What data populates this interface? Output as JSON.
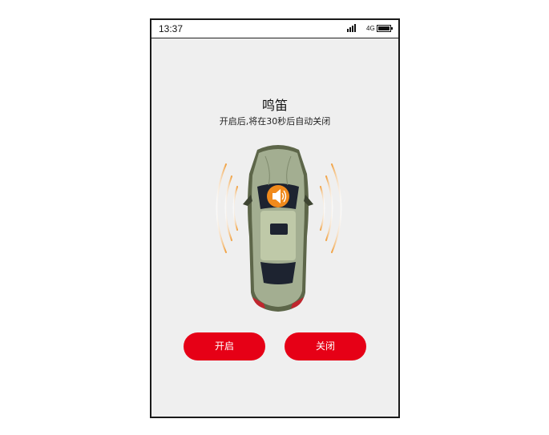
{
  "status_bar": {
    "time": "13:37",
    "network": "4G",
    "icons": [
      "signal-icon",
      "battery-icon"
    ]
  },
  "horn": {
    "title": "鸣笛",
    "subtitle": "开启后,将在30秒后自动关闭",
    "icon": "horn-icon"
  },
  "buttons": {
    "on_label": "开启",
    "off_label": "关闭"
  },
  "colors": {
    "accent": "#e60016",
    "horn_badge": "#f08a1c",
    "car_body": "#9aa58a",
    "background": "#efefef"
  }
}
